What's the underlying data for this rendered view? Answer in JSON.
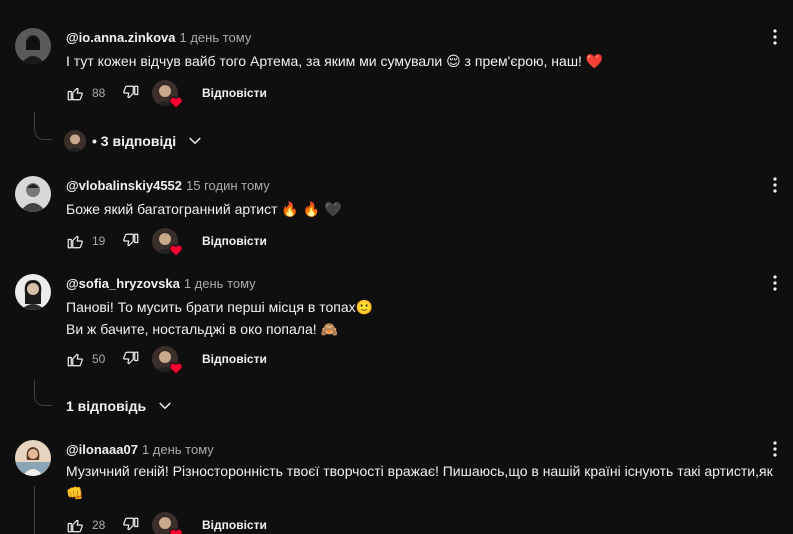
{
  "comments": [
    {
      "author": "@io.anna.zinkova",
      "time": "1 день тому",
      "lines": [
        "І тут кожен відчув вайб того Артема, за яким ми сумували 😌 з прем'єрою, наш! ❤️"
      ],
      "likes": "88",
      "reply_label": "Відповісти",
      "replies_label": "• 3 відповіді"
    },
    {
      "author": "@vlobalinskiy4552",
      "time": "15 годин тому",
      "lines": [
        "Боже який багатогранний артист 🔥 🔥 🖤"
      ],
      "likes": "19",
      "reply_label": "Відповісти"
    },
    {
      "author": "@sofia_hryzovska",
      "time": "1 день тому",
      "lines": [
        "Панові! То мусить брати перші місця в топах🙂",
        "Ви ж бачите, ностальджі в око попала! 🙈"
      ],
      "likes": "50",
      "reply_label": "Відповісти",
      "replies_label": "1 відповідь"
    },
    {
      "author": "@ilonaaa07",
      "time": "1 день тому",
      "lines": [
        "Музичний геній! Різносторонність твоєї творчості вражає! Пишаюсь,що в нашій країні існують такі артисти,як",
        "👊"
      ],
      "likes": "28",
      "reply_label": "Відповісти"
    }
  ],
  "icons": {
    "like": "thumbs-up-icon",
    "dislike": "thumbs-down-icon",
    "menu": "more-vert-icon",
    "heart": "creator-heart-icon",
    "expand": "chevron-down-icon"
  },
  "colors": {
    "background": "#0f0f0f",
    "text": "#f1f1f1",
    "secondary_text": "#aaaaaa",
    "heart": "#ff0033",
    "thread_line": "#3f3f3f"
  }
}
